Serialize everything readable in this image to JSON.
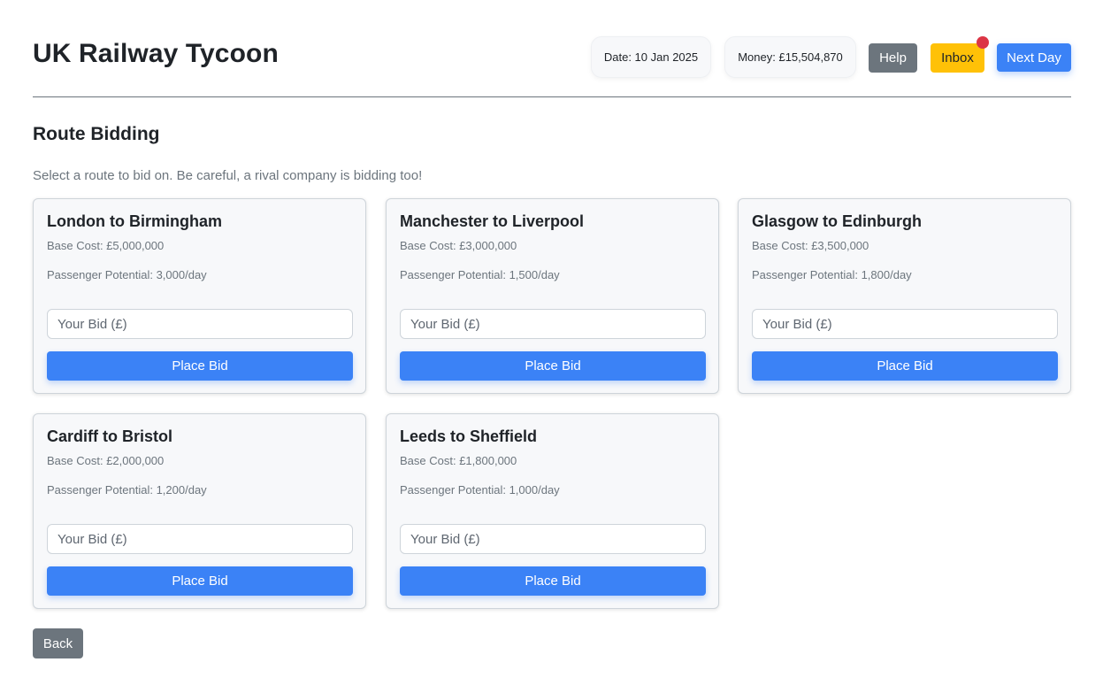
{
  "app": {
    "title": "UK Railway Tycoon"
  },
  "header": {
    "date": "Date: 10 Jan 2025",
    "money": "Money: £15,504,870",
    "help_label": "Help",
    "inbox_label": "Inbox",
    "next_day_label": "Next Day",
    "inbox_has_unread": true
  },
  "section": {
    "title": "Route Bidding",
    "description": "Select a route to bid on. Be careful, a rival company is bidding too!"
  },
  "routes": [
    {
      "name": "London to Birmingham",
      "base_cost": "Base Cost: £5,000,000",
      "potential": "Passenger Potential: 3,000/day",
      "bid_placeholder": "Your Bid (£)",
      "bid_button": "Place Bid"
    },
    {
      "name": "Manchester to Liverpool",
      "base_cost": "Base Cost: £3,000,000",
      "potential": "Passenger Potential: 1,500/day",
      "bid_placeholder": "Your Bid (£)",
      "bid_button": "Place Bid"
    },
    {
      "name": "Glasgow to Edinburgh",
      "base_cost": "Base Cost: £3,500,000",
      "potential": "Passenger Potential: 1,800/day",
      "bid_placeholder": "Your Bid (£)",
      "bid_button": "Place Bid"
    },
    {
      "name": "Cardiff to Bristol",
      "base_cost": "Base Cost: £2,000,000",
      "potential": "Passenger Potential: 1,200/day",
      "bid_placeholder": "Your Bid (£)",
      "bid_button": "Place Bid"
    },
    {
      "name": "Leeds to Sheffield",
      "base_cost": "Base Cost: £1,800,000",
      "potential": "Passenger Potential: 1,000/day",
      "bid_placeholder": "Your Bid (£)",
      "bid_button": "Place Bid"
    }
  ],
  "footer": {
    "back_label": "Back"
  },
  "colors": {
    "primary": "#3b82f6",
    "secondary": "#6c757d",
    "warning": "#ffc107",
    "notification": "#dc3545"
  }
}
